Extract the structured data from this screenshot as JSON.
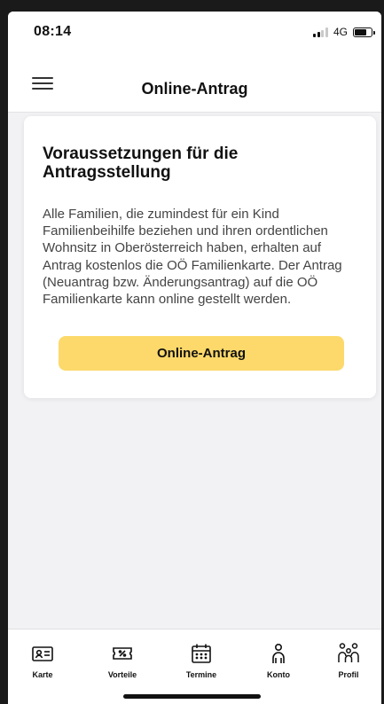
{
  "status": {
    "time": "08:14",
    "network": "4G"
  },
  "appbar": {
    "title": "Online-Antrag"
  },
  "card": {
    "title": "Voraussetzungen für die Antragsstellung",
    "body": "Alle Familien, die zumindest für ein Kind Familienbeihilfe beziehen und ihren ordentlichen Wohnsitz in Oberösterreich haben, erhalten auf Antrag kostenlos die OÖ Familienkarte. Der Antrag (Neuantrag bzw. Änderungsantrag) auf die OÖ Familienkarte kann online gestellt werden.",
    "button_label": "Online-Antrag"
  },
  "tabbar": {
    "items": [
      {
        "label": "Karte",
        "icon": "id-card-icon"
      },
      {
        "label": "Vorteile",
        "icon": "voucher-icon"
      },
      {
        "label": "Termine",
        "icon": "calendar-icon"
      },
      {
        "label": "Konto",
        "icon": "person-icon"
      },
      {
        "label": "Profil",
        "icon": "family-icon"
      }
    ]
  },
  "colors": {
    "accent": "#fcd96a",
    "background": "#f2f2f4"
  }
}
